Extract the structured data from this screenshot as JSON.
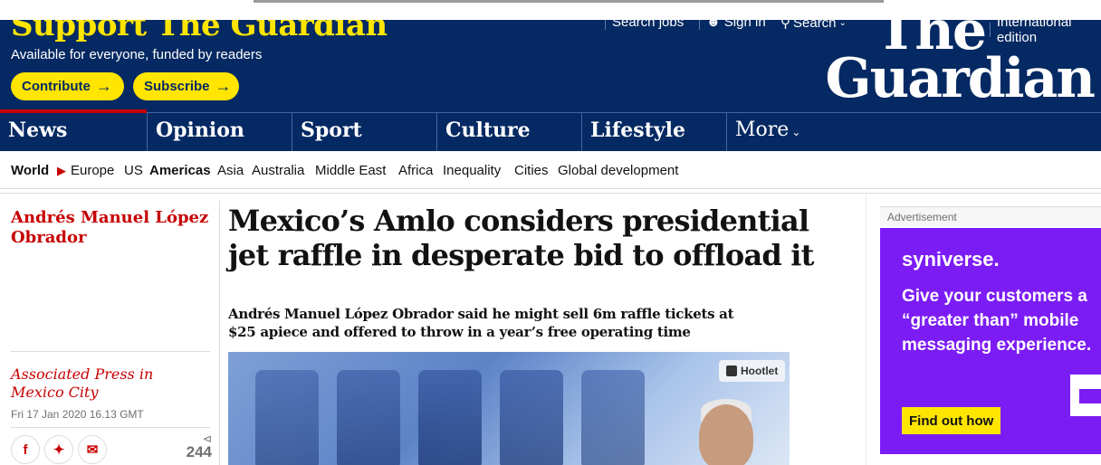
{
  "support": {
    "title": "Support The Guardian",
    "subtitle": "Available for everyone, funded by readers",
    "contribute_label": "Contribute",
    "subscribe_label": "Subscribe"
  },
  "header_links": {
    "jobs": "Search jobs",
    "sign_in": "Sign in",
    "search": "Search",
    "edition": "International edition"
  },
  "logo": {
    "line1": "The",
    "line2": "Guardian"
  },
  "pillars": [
    {
      "label": "News"
    },
    {
      "label": "Opinion"
    },
    {
      "label": "Sport"
    },
    {
      "label": "Culture"
    },
    {
      "label": "Lifestyle"
    },
    {
      "label": "More"
    }
  ],
  "subnav": {
    "section": "World",
    "items": [
      "Europe",
      "US",
      "Americas",
      "Asia",
      "Australia",
      "Middle East",
      "Africa",
      "Inequality",
      "Cities",
      "Global development"
    ],
    "active": "Americas"
  },
  "article": {
    "series": "Andrés Manuel López Obrador",
    "headline": "Mexico’s Amlo considers presidential jet raffle in desperate bid to offload it",
    "standfirst": "Andrés Manuel López Obrador said he might sell 6m raffle tickets at $25 apiece and offered to throw in a year’s free operating time",
    "byline": "Associated Press in Mexico City",
    "date": "Fri 17 Jan 2020 16.13 GMT",
    "share_count": "244",
    "image_badge": "Hootlet"
  },
  "ad": {
    "label": "Advertisement",
    "brand": "syniverse.",
    "copy": "Give your customers a “greater than” mobile messaging experience.",
    "cta": "Find out how"
  },
  "colors": {
    "brand_blue": "#052962",
    "support_yellow": "#ffe500",
    "news_red": "#c70000",
    "ad_purple": "#7c1cf5"
  }
}
